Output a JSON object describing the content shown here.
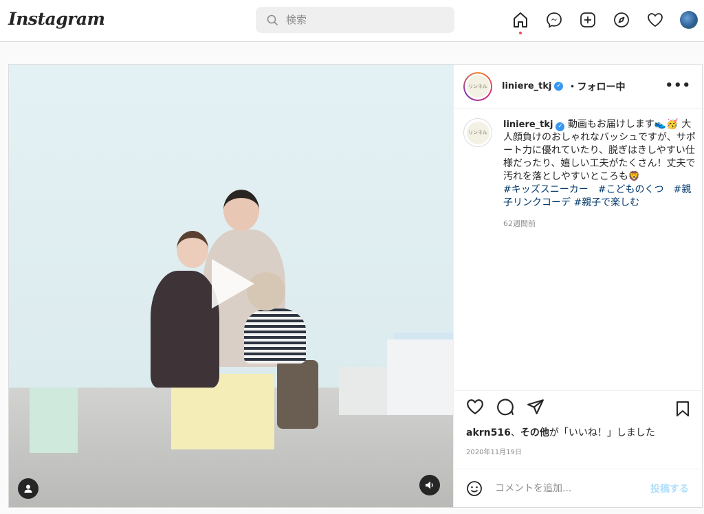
{
  "app": {
    "logo": "Instagram"
  },
  "search": {
    "placeholder": "検索"
  },
  "nav": {
    "icons": [
      "home-icon",
      "messenger-icon",
      "new-post-icon",
      "explore-icon",
      "activity-heart-icon",
      "profile-avatar"
    ]
  },
  "post": {
    "header": {
      "username": "liniere_tkj",
      "verified_mark": "✓",
      "follow_status": "・フォロー中",
      "more": "•••",
      "avatar_text": "リンネル"
    },
    "caption": {
      "username": "liniere_tkj",
      "text": "動画もお届けします👟🥳 大人顔負けのおしゃれなバッシュですが、サポート力に優れていたり、脱ぎはきしやすい仕様だったり、嬉しい工夫がたくさん！丈夫で汚れを落としやすいところも🦁",
      "tags": "#キッズスニーカー　#こどものくつ　#親子リンクコーデ #親子で楽しむ",
      "time_ago": "62週間前"
    },
    "likes": {
      "user": "akrn516",
      "sep": "、",
      "others": "その他",
      "suffix": "が「いいね！」しました"
    },
    "date": "2020年11月19日",
    "comment": {
      "placeholder": "コメントを追加...",
      "post_label": "投稿する"
    }
  },
  "colors": {
    "accent": "#3897f0",
    "like_dot": "#ed4956",
    "post_disabled": "#b2dffc"
  }
}
